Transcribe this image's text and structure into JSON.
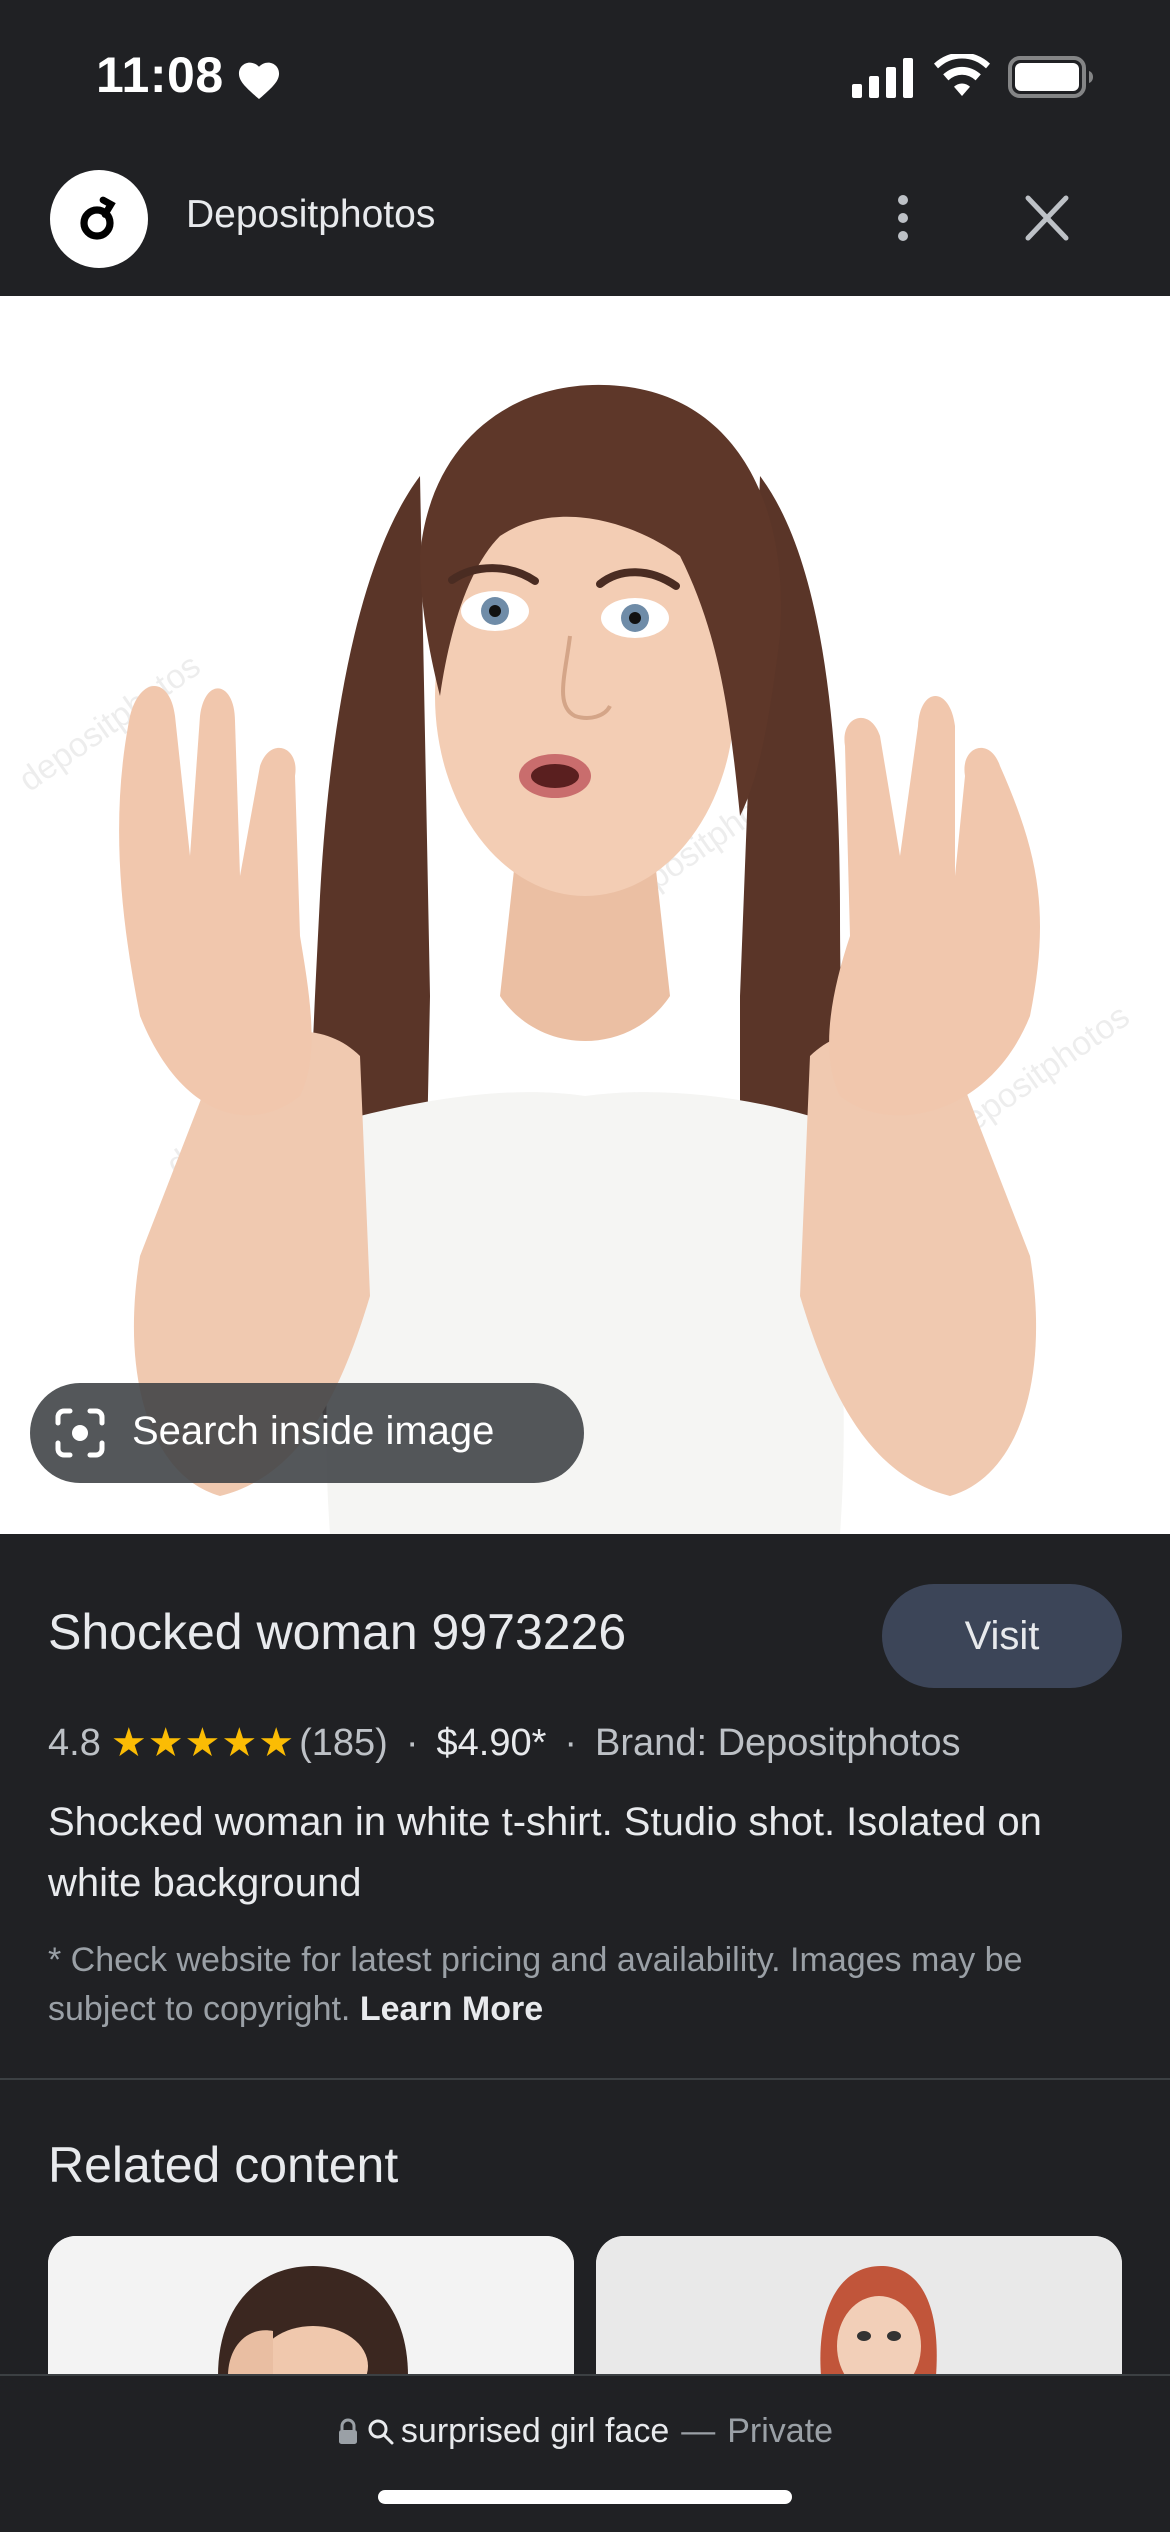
{
  "status_bar": {
    "time": "11:08",
    "icons": [
      "heart-icon",
      "signal-icon",
      "wifi-icon",
      "battery-icon"
    ]
  },
  "header": {
    "site_name": "Depositphotos",
    "logo_icon": "depositphotos-logo",
    "more_icon": "more-vert-icon",
    "close_icon": "close-icon"
  },
  "image": {
    "search_inside_label": "Search inside image",
    "watermark": "depositphotos"
  },
  "result": {
    "title": "Shocked woman 9973226",
    "visit_label": "Visit",
    "rating": "4.8",
    "stars": "★★★★★",
    "review_count": "(185)",
    "separator": "·",
    "price": "$4.90*",
    "brand": "Brand: Depositphotos",
    "description": "Shocked woman in white t-shirt. Studio shot. Isolated on white background",
    "disclaimer": "* Check website for latest pricing and availability. Images may be subject to copyright.",
    "learn_more": "Learn More"
  },
  "related": {
    "title": "Related content"
  },
  "bottom_bar": {
    "query": "surprised girl face",
    "dash": "—",
    "private_label": "Private"
  },
  "colors": {
    "background": "#202124",
    "visit_button": "#3c4558",
    "star": "#fbbc04",
    "text_primary": "#e8eaed",
    "text_secondary": "#9aa0a6"
  }
}
